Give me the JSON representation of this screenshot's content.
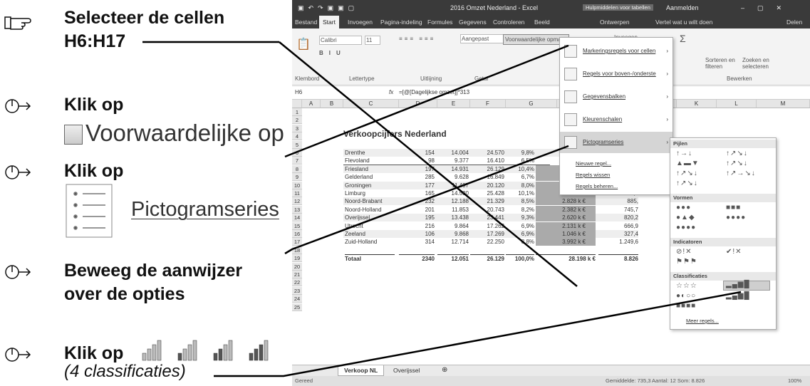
{
  "instructions": {
    "step1": {
      "line1": "Selecteer de cellen",
      "line2": "H6:H17"
    },
    "step2": {
      "label": "Klik op",
      "shot": "Voorwaardelijke op"
    },
    "step3": {
      "label": "Klik op",
      "shot": "Pictogramseries"
    },
    "step4": {
      "line1": "Beweeg de aanwijzer",
      "line2": "over de opties"
    },
    "step5": {
      "label": "Klik op",
      "sub": "(4 classificaties)"
    }
  },
  "excel": {
    "title": "2016 Omzet Nederland - Excel",
    "context_tab": "Hulpmiddelen voor tabellen",
    "signin": "Aanmelden",
    "tabs": [
      "Bestand",
      "Start",
      "Invoegen",
      "Pagina-indeling",
      "Formules",
      "Gegevens",
      "Controleren",
      "Beeld",
      "Ontwerpen"
    ],
    "tellme": "Vertel wat u wilt doen",
    "share": "Delen",
    "ribbon": {
      "font_name": "Calibri",
      "font_size": "11",
      "number_format": "Aangepast",
      "cond_format": "Voorwaardelijke opmaak",
      "insert": "Invoegen",
      "sort": "Sorteren en filteren",
      "find": "Zoeken en selecteren",
      "groups": [
        "Klembord",
        "Lettertype",
        "Uitlijning",
        "Getal",
        "Bewerken"
      ]
    },
    "namebox": "H6",
    "formula": "=[@[Dagelijkse omzet]]*313",
    "columns": [
      "A",
      "B",
      "C",
      "D",
      "E",
      "F",
      "G",
      "H",
      "I",
      "J",
      "K",
      "L",
      "M"
    ],
    "sheet_title": "Verkoopcijfers Nederland",
    "headers": [
      "Provincie",
      "Verkoop-punten",
      "Gemiddeld / VP",
      "",
      "Procent"
    ],
    "rows": [
      [
        "Drenthe",
        "154",
        "14.004",
        "24.570",
        "9,8%",
        "",
        ""
      ],
      [
        "Flevoland",
        "98",
        "9.377",
        "16.410",
        "6,5%",
        "",
        ""
      ],
      [
        "Friesland",
        "197",
        "14.931",
        "26.129",
        "10,4%",
        "2.941 k €",
        "920,7"
      ],
      [
        "Gelderland",
        "285",
        "9.628",
        "16.849",
        "6,7%",
        "2.744 k €",
        "858,9"
      ],
      [
        "Groningen",
        "177",
        "11.497",
        "20.120",
        "8,0%",
        "2.035 k €",
        "636,9"
      ],
      [
        "Limburg",
        "165",
        "14.530",
        "25.428",
        "10,1%",
        "2.397 k €",
        "750,4"
      ],
      [
        "Noord-Brabant",
        "232",
        "12.188",
        "21.329",
        "8,5%",
        "2.828 k €",
        "885,"
      ],
      [
        "Noord-Holland",
        "201",
        "11.853",
        "20.743",
        "8,2%",
        "2.382 k €",
        "745,7"
      ],
      [
        "Overijssel",
        "195",
        "13.438",
        "23.441",
        "9,3%",
        "2.620 k €",
        "820,2"
      ],
      [
        "Utrecht",
        "216",
        "9.864",
        "17.262",
        "6,9%",
        "2.131 k €",
        "666,9"
      ],
      [
        "Zeeland",
        "106",
        "9.868",
        "17.269",
        "6,9%",
        "1.046 k €",
        "327,4"
      ],
      [
        "Zuid-Holland",
        "314",
        "12.714",
        "22.250",
        "8,8%",
        "3.992 k €",
        "1.249,6"
      ]
    ],
    "total": [
      "Totaal",
      "2340",
      "12.051",
      "26.129",
      "100,0%",
      "28.198 k €",
      "8.826"
    ],
    "sheet_tabs": [
      "Verkoop NL",
      "Overijssel"
    ],
    "status": {
      "left": "Gereed",
      "right": "Gemiddelde: 735,3   Aantal: 12   Som: 8.826",
      "zoom": "100%"
    },
    "menu": {
      "items": [
        "Markeringsregels voor cellen",
        "Regels voor boven-/onderste",
        "Gegevensbalken",
        "Kleurenschalen",
        "Pictogramseries"
      ],
      "small": [
        "Nieuwe regel...",
        "Regels wissen",
        "Regels beheren..."
      ]
    },
    "submenu": {
      "sections": [
        "Pijlen",
        "Vormen",
        "Indicatoren",
        "Classificaties"
      ],
      "more": "Meer regels..."
    }
  }
}
